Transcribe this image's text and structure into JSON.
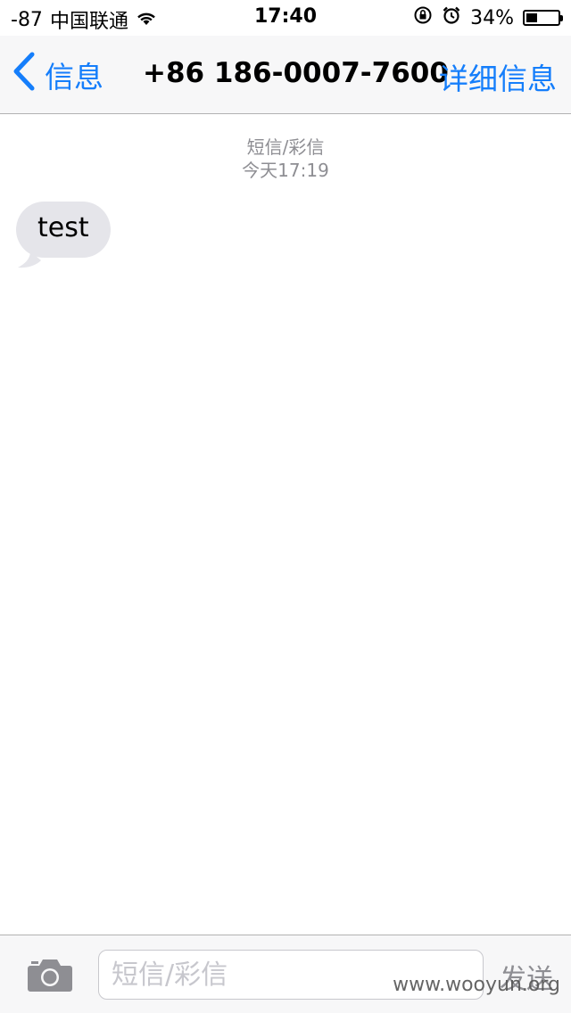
{
  "status_bar": {
    "signal": "-87",
    "carrier": "中国联通",
    "time": "17:40",
    "battery_percent_text": "34%",
    "battery_level": 0.34,
    "icons": [
      "wifi-icon",
      "orientation-lock-icon",
      "alarm-icon",
      "battery-icon"
    ]
  },
  "nav": {
    "back_label": "信息",
    "title": "+86 186-0007-7600",
    "detail_label": "详细信息"
  },
  "conversation": {
    "message_type": "短信/彩信",
    "timestamp": "今天17:19",
    "messages": [
      {
        "direction": "incoming",
        "text": "test"
      }
    ]
  },
  "input_bar": {
    "placeholder": "短信/彩信",
    "send_label": "发送",
    "camera_icon": "camera-icon"
  },
  "watermark": "www.wooyun.org",
  "colors": {
    "accent": "#157efb",
    "bubble_incoming": "#e5e5ea",
    "bar_background": "#f7f7f8",
    "meta_text": "#8e8e93"
  }
}
